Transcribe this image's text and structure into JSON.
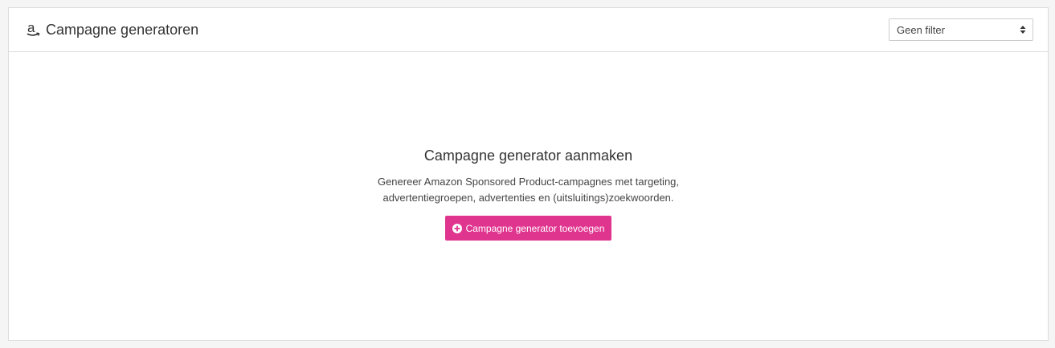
{
  "panel": {
    "title": "Campagne generatoren",
    "icon": "amazon-icon",
    "filter": {
      "selected": "Geen filter",
      "icon": "sort-updown-icon"
    }
  },
  "empty_state": {
    "title": "Campagne generator aanmaken",
    "description_line1": "Genereer Amazon Sponsored Product-campagnes met targeting,",
    "description_line2": "advertentiegroepen, advertenties en (uitsluitings)zoekwoorden.",
    "button_label": "Campagne generator toevoegen",
    "button_icon": "plus-circle-icon"
  },
  "colors": {
    "accent": "#e0358f",
    "border": "#dcdcdc",
    "background": "#f5f5f5"
  }
}
